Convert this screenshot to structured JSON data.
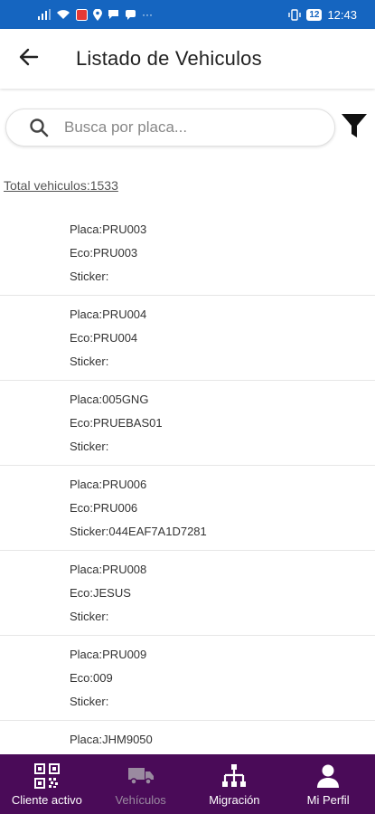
{
  "status_bar": {
    "time": "12:43",
    "battery": "12",
    "overflow": "···"
  },
  "app_bar": {
    "title": "Listado de Vehiculos"
  },
  "search": {
    "placeholder": "Busca por placa..."
  },
  "total": {
    "text": "Total vehiculos:1533"
  },
  "vehicles": [
    {
      "placa": "Placa:PRU003",
      "eco": "Eco:PRU003",
      "sticker": "Sticker:"
    },
    {
      "placa": "Placa:PRU004",
      "eco": "Eco:PRU004",
      "sticker": "Sticker:"
    },
    {
      "placa": "Placa:005GNG",
      "eco": "Eco:PRUEBAS01",
      "sticker": "Sticker:"
    },
    {
      "placa": "Placa:PRU006",
      "eco": "Eco:PRU006",
      "sticker": "Sticker:044EAF7A1D7281"
    },
    {
      "placa": "Placa:PRU008",
      "eco": "Eco:JESUS",
      "sticker": "Sticker:"
    },
    {
      "placa": "Placa:PRU009",
      "eco": "Eco:009",
      "sticker": "Sticker:"
    },
    {
      "placa": "Placa:JHM9050",
      "eco": "",
      "sticker": ""
    }
  ],
  "bottom_nav": {
    "active_index": 1,
    "items": [
      {
        "label": "Cliente activo",
        "icon": "qr-code-icon"
      },
      {
        "label": "Vehículos",
        "icon": "truck-icon"
      },
      {
        "label": "Migración",
        "icon": "hierarchy-icon"
      },
      {
        "label": "Mi Perfil",
        "icon": "person-icon"
      }
    ]
  },
  "colors": {
    "status_bar": "#1565c0",
    "bottom_nav": "#4a0b58",
    "nav_inactive_label": "#9a8aa0"
  }
}
